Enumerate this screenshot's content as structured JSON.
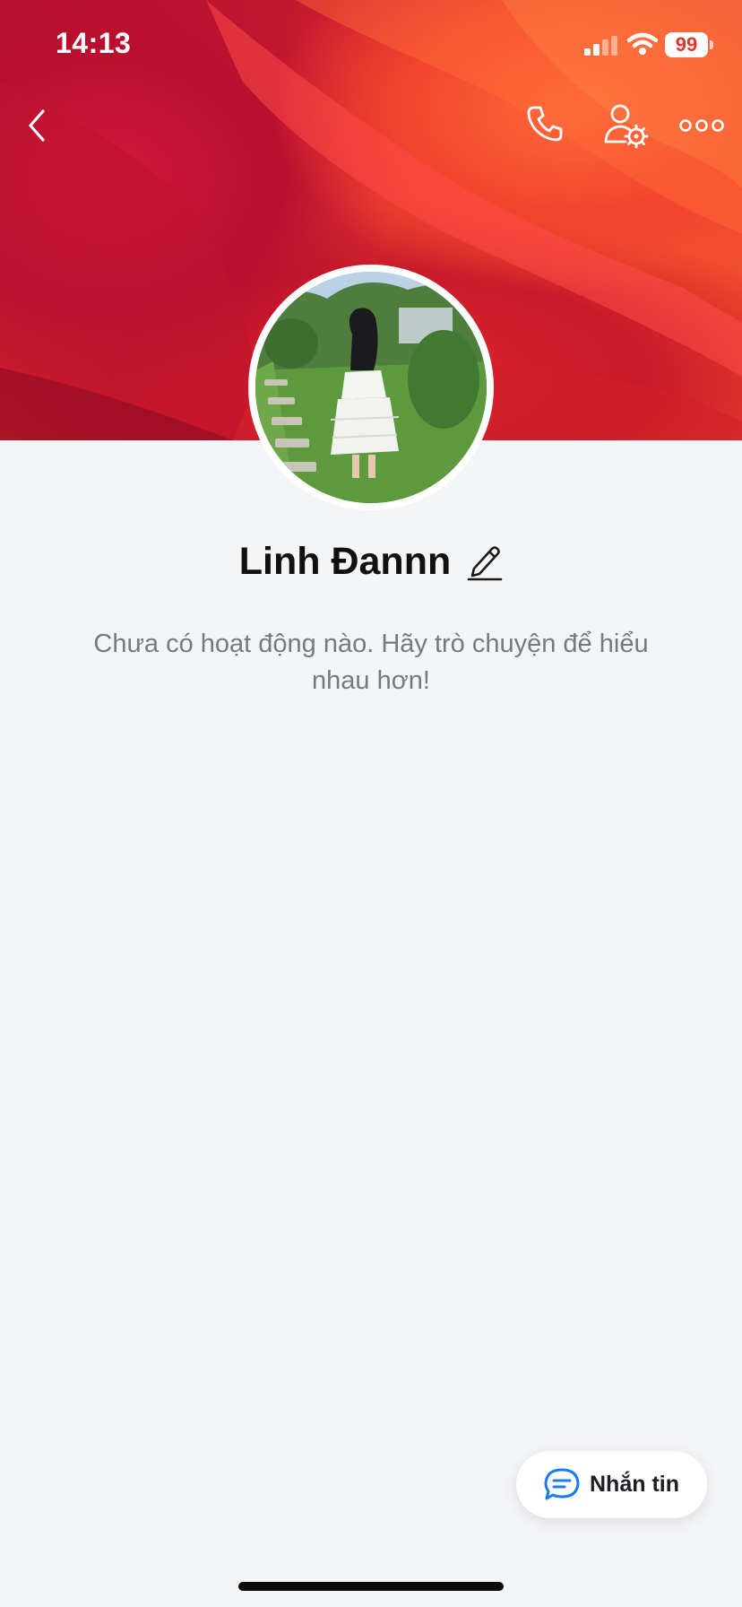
{
  "status_bar": {
    "time": "14:13",
    "battery": "99"
  },
  "nav": {
    "back_icon": "chevron-left-icon",
    "call_icon": "phone-icon",
    "settings_icon": "user-gear-icon",
    "more_icon": "more-dots-icon"
  },
  "profile": {
    "name": "Linh Đannn",
    "empty_message": "Chưa có hoạt động nào. Hãy trò chuyện để hiểu nhau hơn!"
  },
  "message_button": {
    "label": "Nhắn tin",
    "icon": "chat-bubble-icon"
  },
  "colors": {
    "background": "#f4f5f7",
    "cover_red": "#e12a35",
    "chat_icon_blue": "#1a7cf0",
    "battery_text": "#e8342b"
  }
}
